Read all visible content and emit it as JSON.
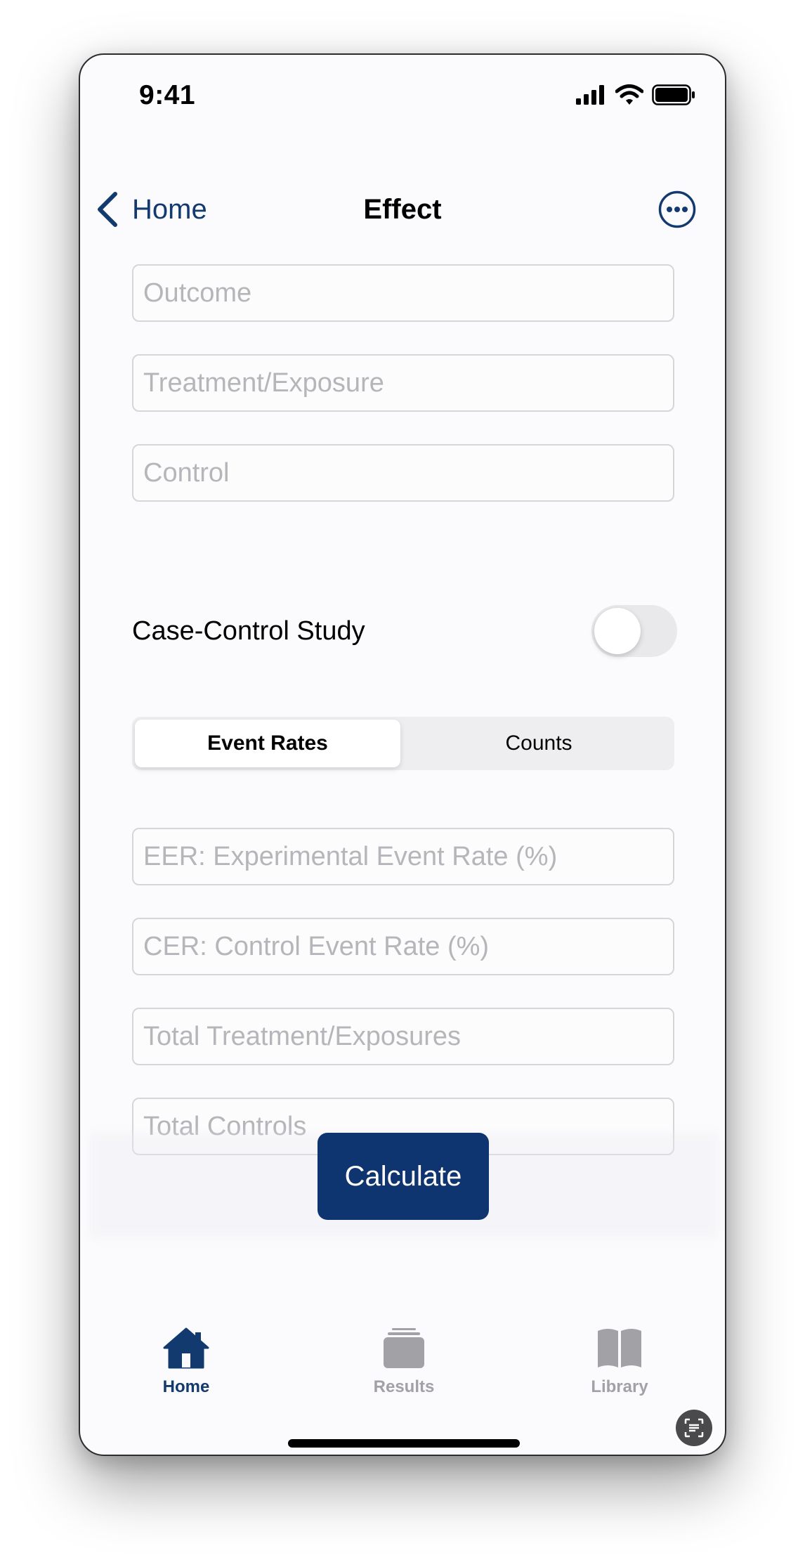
{
  "status_bar": {
    "time": "9:41"
  },
  "nav": {
    "back_label": "Home",
    "title": "Effect"
  },
  "form": {
    "outcome_placeholder": "Outcome",
    "treatment_placeholder": "Treatment/Exposure",
    "control_placeholder": "Control",
    "case_control_label": "Case-Control Study",
    "case_control_on": false,
    "segments": [
      {
        "label": "Event Rates",
        "selected": true
      },
      {
        "label": "Counts",
        "selected": false
      }
    ],
    "eer_placeholder": "EER: Experimental Event Rate (%)",
    "cer_placeholder": "CER: Control Event Rate (%)",
    "total_treatment_placeholder": "Total Treatment/Exposures",
    "total_controls_placeholder": "Total Controls",
    "calculate_label": "Calculate"
  },
  "tab_bar": {
    "items": [
      {
        "label": "Home",
        "icon": "house-icon",
        "active": true
      },
      {
        "label": "Results",
        "icon": "stack-icon",
        "active": false
      },
      {
        "label": "Library",
        "icon": "book-icon",
        "active": false
      }
    ]
  },
  "colors": {
    "accent": "#133a6f",
    "button": "#0f3570",
    "inactive": "#a1a1a6",
    "placeholder": "#b5b5ba"
  }
}
